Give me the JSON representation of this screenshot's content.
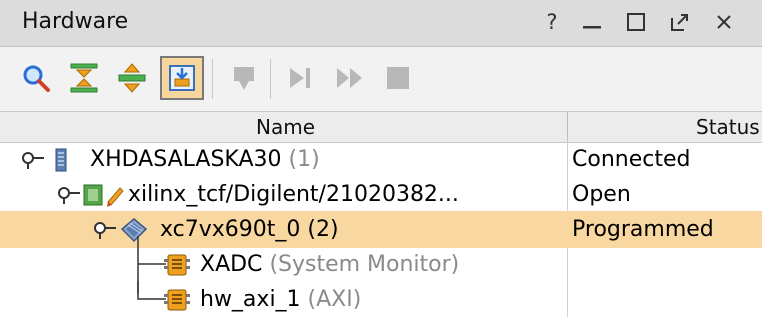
{
  "panel": {
    "title": "Hardware",
    "controls": [
      "?",
      "minimize",
      "maximize",
      "float",
      "close"
    ]
  },
  "toolbar": {
    "buttons": [
      {
        "name": "search",
        "icon": "search-icon",
        "enabled": true
      },
      {
        "name": "collapse-all",
        "icon": "collapse-all-icon",
        "enabled": true
      },
      {
        "name": "expand-all",
        "icon": "expand-all-icon",
        "enabled": true
      },
      {
        "name": "auto-connect",
        "icon": "auto-connect-icon",
        "enabled": true,
        "active": true
      },
      {
        "name": "program-device",
        "icon": "program-device-icon",
        "enabled": false
      },
      {
        "name": "run-trigger",
        "icon": "run-trigger-icon",
        "enabled": false
      },
      {
        "name": "run-trigger-immediate",
        "icon": "run-immediate-icon",
        "enabled": false
      },
      {
        "name": "stop-trigger",
        "icon": "stop-icon",
        "enabled": false
      }
    ]
  },
  "table": {
    "columns": [
      "Name",
      "Status"
    ],
    "rows": [
      {
        "name": "XHDASALASKA30",
        "suffix": "(1)",
        "status": "Connected",
        "icon": "server-icon"
      },
      {
        "name": "xilinx_tcf/Digilent/21020382...",
        "suffix": "",
        "status": "Open",
        "icon": "jtag-target-icon"
      },
      {
        "name": "xc7vx690t_0",
        "suffix": "(2)",
        "status": "Programmed",
        "icon": "fpga-device-icon",
        "selected": true
      },
      {
        "name": "XADC",
        "suffix": "(System Monitor)",
        "status": "",
        "icon": "debug-core-icon"
      },
      {
        "name": "hw_axi_1",
        "suffix": "(AXI)",
        "status": "",
        "icon": "debug-core-icon"
      }
    ]
  },
  "colors": {
    "title_bar": "#dcdcdc",
    "selected_row": "#f8d7a0",
    "active_button": "#f6d69c",
    "muted_text": "#8a8a8a"
  }
}
